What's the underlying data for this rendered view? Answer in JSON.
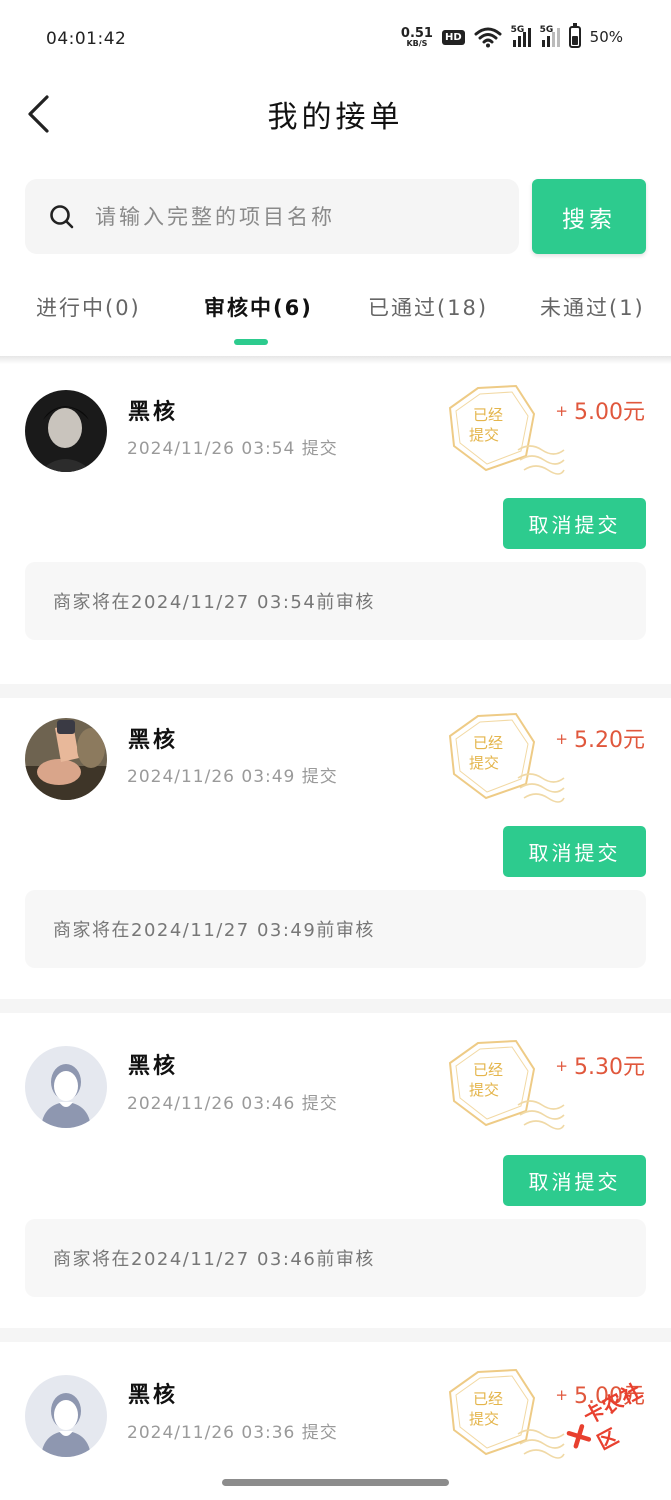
{
  "status_bar": {
    "time": "04:01:42",
    "net_speed": "0.51",
    "net_unit": "KB/S",
    "hd": "HD",
    "sim1": "5G",
    "sim2": "5G",
    "battery": "50%"
  },
  "header": {
    "title": "我的接单",
    "back_icon": "chevron-left-icon"
  },
  "search": {
    "placeholder": "请输入完整的项目名称",
    "value": "",
    "button_label": "搜索",
    "icon": "search-icon"
  },
  "tabs": [
    {
      "label": "进行中(0)",
      "active": false
    },
    {
      "label": "审核中(6)",
      "active": true
    },
    {
      "label": "已通过(18)",
      "active": false
    },
    {
      "label": "未通过(1)",
      "active": false
    }
  ],
  "orders": [
    {
      "name": "黑核",
      "time": "2024/11/26 03:54 提交",
      "stamp_text": "已经提交",
      "reward_sign": "+",
      "reward": "5.00元",
      "cancel_label": "取消提交",
      "note": "商家将在2024/11/27 03:54前审核",
      "avatar": "avatar-dark-photo"
    },
    {
      "name": "黑核",
      "time": "2024/11/26 03:49 提交",
      "stamp_text": "已经提交",
      "reward_sign": "+",
      "reward": "5.20元",
      "cancel_label": "取消提交",
      "note": "商家将在2024/11/27 03:49前审核",
      "avatar": "avatar-photo"
    },
    {
      "name": "黑核",
      "time": "2024/11/26 03:46 提交",
      "stamp_text": "已经提交",
      "reward_sign": "+",
      "reward": "5.30元",
      "cancel_label": "取消提交",
      "note": "商家将在2024/11/27 03:46前审核",
      "avatar": "default-avatar-icon"
    },
    {
      "name": "黑核",
      "time": "2024/11/26 03:36 提交",
      "stamp_text": "已经提交",
      "reward_sign": "+",
      "reward": "5.00元",
      "avatar": "default-avatar-icon"
    }
  ],
  "watermark": "卡农社区",
  "colors": {
    "accent": "#2dcb8e",
    "reward": "#e0573c",
    "stamp": "#e8c46a"
  }
}
